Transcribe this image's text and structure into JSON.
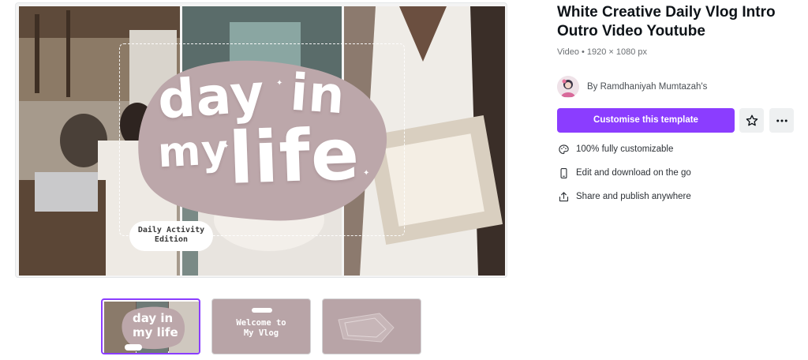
{
  "preview": {
    "title_words": [
      "day",
      "in",
      "my",
      "life"
    ],
    "edition_line1": "Daily Activity",
    "edition_line2": "Edition"
  },
  "thumbnails": [
    {
      "label_line1": "day in",
      "label_line2": "my life"
    },
    {
      "label_line1": "Welcome to",
      "label_line2": "My Vlog"
    },
    {
      "label_line1": "",
      "label_line2": ""
    }
  ],
  "template": {
    "title": "White Creative Daily Vlog Intro Outro Video Youtube",
    "meta": "Video • 1920 × 1080 px",
    "author": "By Ramdhaniyah Mumtazah's"
  },
  "actions": {
    "customise_label": "Customise this template",
    "star_icon": "star-icon",
    "more_icon": "more-icon"
  },
  "features": [
    {
      "icon": "palette-icon",
      "label": "100% fully customizable"
    },
    {
      "icon": "phone-icon",
      "label": "Edit and download on the go"
    },
    {
      "icon": "share-icon",
      "label": "Share and publish anywhere"
    }
  ],
  "colors": {
    "accent": "#8b3dff",
    "blob": "#bca7aa",
    "thumb_bg": "#b8a4a7"
  }
}
